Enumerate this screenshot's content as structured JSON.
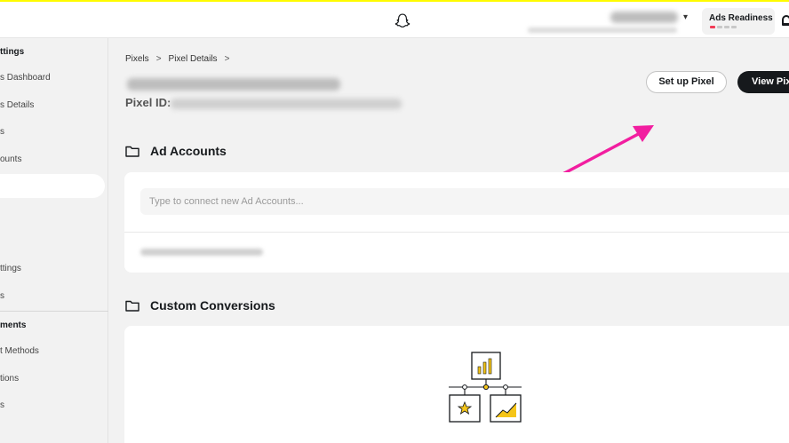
{
  "topbar": {
    "logo_icon": "snapchat-ghost-icon",
    "ads_readiness_label": "Ads Readiness",
    "ads_readiness_progress": 0.25,
    "accent_color": "#fffc00",
    "progress_color": "#f23c57"
  },
  "sidebar": {
    "items": [
      {
        "label": "ttings",
        "type": "header"
      },
      {
        "label": "s Dashboard",
        "type": "item"
      },
      {
        "label": "s Details",
        "type": "item"
      },
      {
        "label": "s",
        "type": "item"
      },
      {
        "label": "ounts",
        "type": "item"
      },
      {
        "label": "",
        "type": "active"
      },
      {
        "label": "ttings",
        "type": "item"
      },
      {
        "label": "s",
        "type": "item"
      },
      {
        "label": "ments",
        "type": "header"
      },
      {
        "label": "t Methods",
        "type": "item"
      },
      {
        "label": "tions",
        "type": "item"
      },
      {
        "label": "s",
        "type": "item"
      }
    ]
  },
  "breadcrumb": {
    "items": [
      "Pixels",
      "Pixel Details"
    ],
    "separator": ">"
  },
  "pixel": {
    "id_label": "Pixel ID:"
  },
  "actions": {
    "setup_label": "Set up Pixel",
    "view_label": "View Pix"
  },
  "ad_accounts": {
    "title": "Ad Accounts",
    "input_placeholder": "Type to connect new Ad Accounts..."
  },
  "custom_conversions": {
    "title": "Custom Conversions"
  },
  "annotation": {
    "arrow_color": "#f21ea0"
  }
}
